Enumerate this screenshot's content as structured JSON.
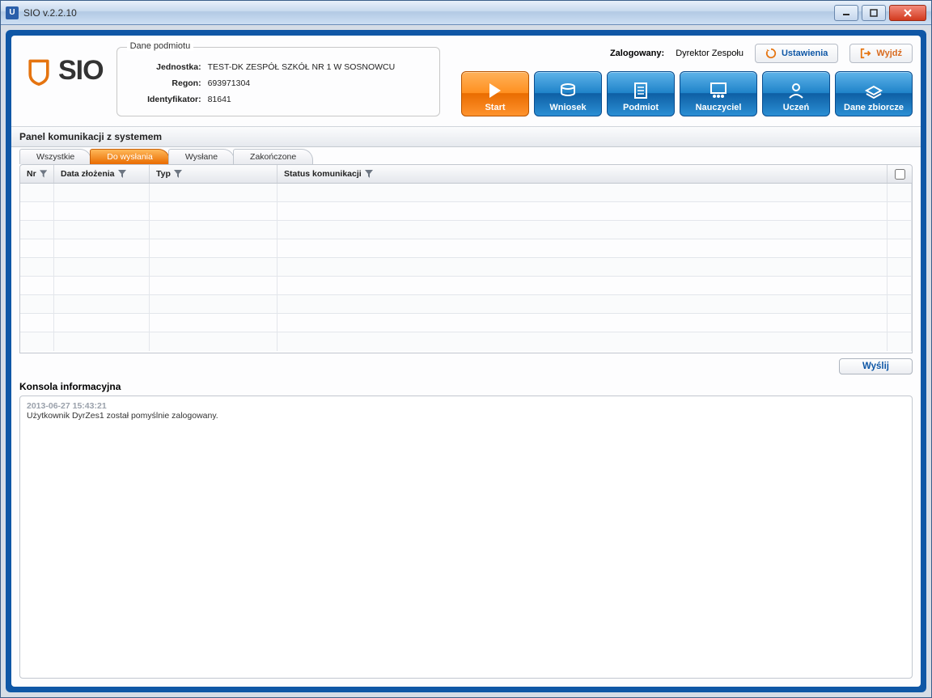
{
  "window": {
    "title": "SIO v.2.2.10"
  },
  "logo": {
    "text": "SIO"
  },
  "entity": {
    "legend": "Dane podmiotu",
    "rows": [
      {
        "k": "Jednostka:",
        "v": "TEST-DK ZESPÓŁ SZKÓŁ NR 1 W SOSNOWCU"
      },
      {
        "k": "Regon:",
        "v": "693971304"
      },
      {
        "k": "Identyfikator:",
        "v": "81641"
      }
    ]
  },
  "login": {
    "label": "Zalogowany:",
    "value": "Dyrektor Zespołu"
  },
  "actions": {
    "settings": "Ustawienia",
    "exit": "Wyjdź"
  },
  "bigbuttons": [
    {
      "name": "start",
      "label": "Start",
      "style": "start"
    },
    {
      "name": "wniosek",
      "label": "Wniosek"
    },
    {
      "name": "podmiot",
      "label": "Podmiot"
    },
    {
      "name": "nauczyciel",
      "label": "Nauczyciel",
      "wide": true
    },
    {
      "name": "uczen",
      "label": "Uczeń"
    },
    {
      "name": "dane-zbiorcze",
      "label": "Dane zbiorcze",
      "wide": true
    }
  ],
  "panel": {
    "title": "Panel komunikacji z systemem"
  },
  "tabs": [
    {
      "name": "wszystkie",
      "label": "Wszystkie"
    },
    {
      "name": "do-wyslania",
      "label": "Do wysłania",
      "active": true
    },
    {
      "name": "wyslane",
      "label": "Wysłane"
    },
    {
      "name": "zakonczone",
      "label": "Zakończone"
    }
  ],
  "grid": {
    "cols": {
      "nr": "Nr",
      "date": "Data złożenia",
      "typ": "Typ",
      "status": "Status komunikacji"
    },
    "rows": 9
  },
  "send": "Wyślij",
  "console": {
    "title": "Konsola informacyjna",
    "ts": "2013-06-27 15:43:21",
    "msg": "Użytkownik DyrZes1 został pomyślnie zalogowany."
  }
}
